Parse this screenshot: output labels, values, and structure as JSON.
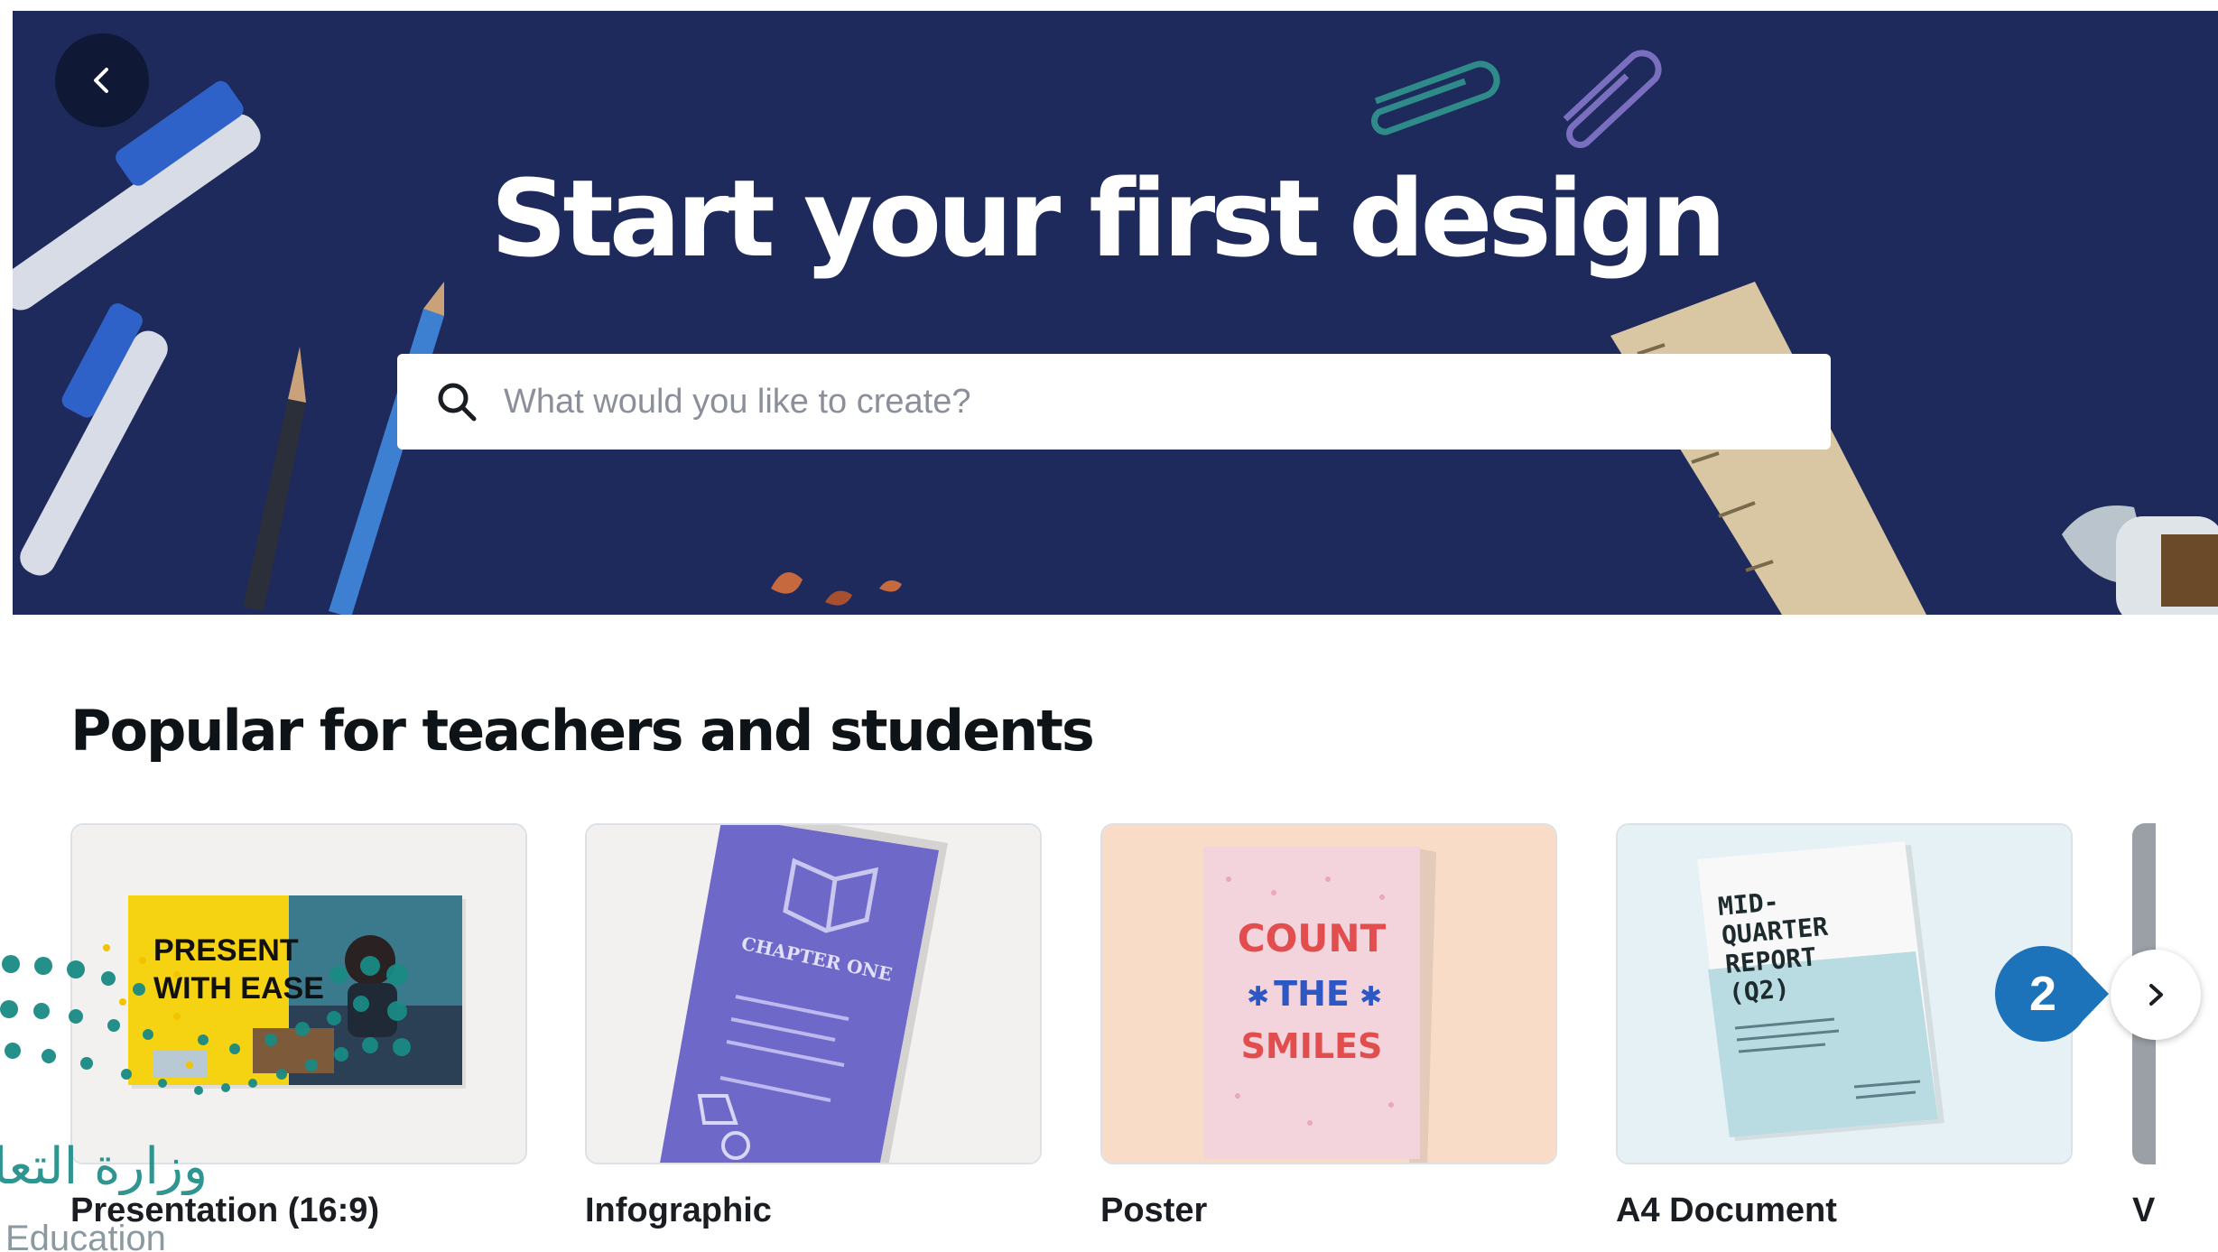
{
  "hero": {
    "title": "Start your first design",
    "search_placeholder": "What would you like to create?"
  },
  "section": {
    "title": "Popular for teachers and students"
  },
  "cards": [
    {
      "label": "Presentation (16:9)",
      "thumbnail_text_line1": "PRESENT",
      "thumbnail_text_line2": "WITH EASE"
    },
    {
      "label": "Infographic",
      "thumbnail_text": "CHAPTER ONE"
    },
    {
      "label": "Poster",
      "thumbnail_text_line1": "COUNT",
      "thumbnail_text_line2": "THE",
      "thumbnail_text_line3": "SMILES"
    },
    {
      "label": "A4 Document",
      "thumbnail_text_line1": "MID-",
      "thumbnail_text_line2": "QUARTER",
      "thumbnail_text_line3": "REPORT",
      "thumbnail_text_line4": "(Q2)"
    }
  ],
  "partial_card_label": "V",
  "step_badge": "2",
  "watermark": {
    "arabic": "وزارة التعليم",
    "english": "Education"
  },
  "colors": {
    "hero_background": "#1e2a5c",
    "badge_blue": "#1c73b9",
    "watermark_teal": "#1a8a84"
  },
  "icons": {
    "back": "chevron-left-icon",
    "search": "search-icon",
    "next": "chevron-right-icon"
  }
}
